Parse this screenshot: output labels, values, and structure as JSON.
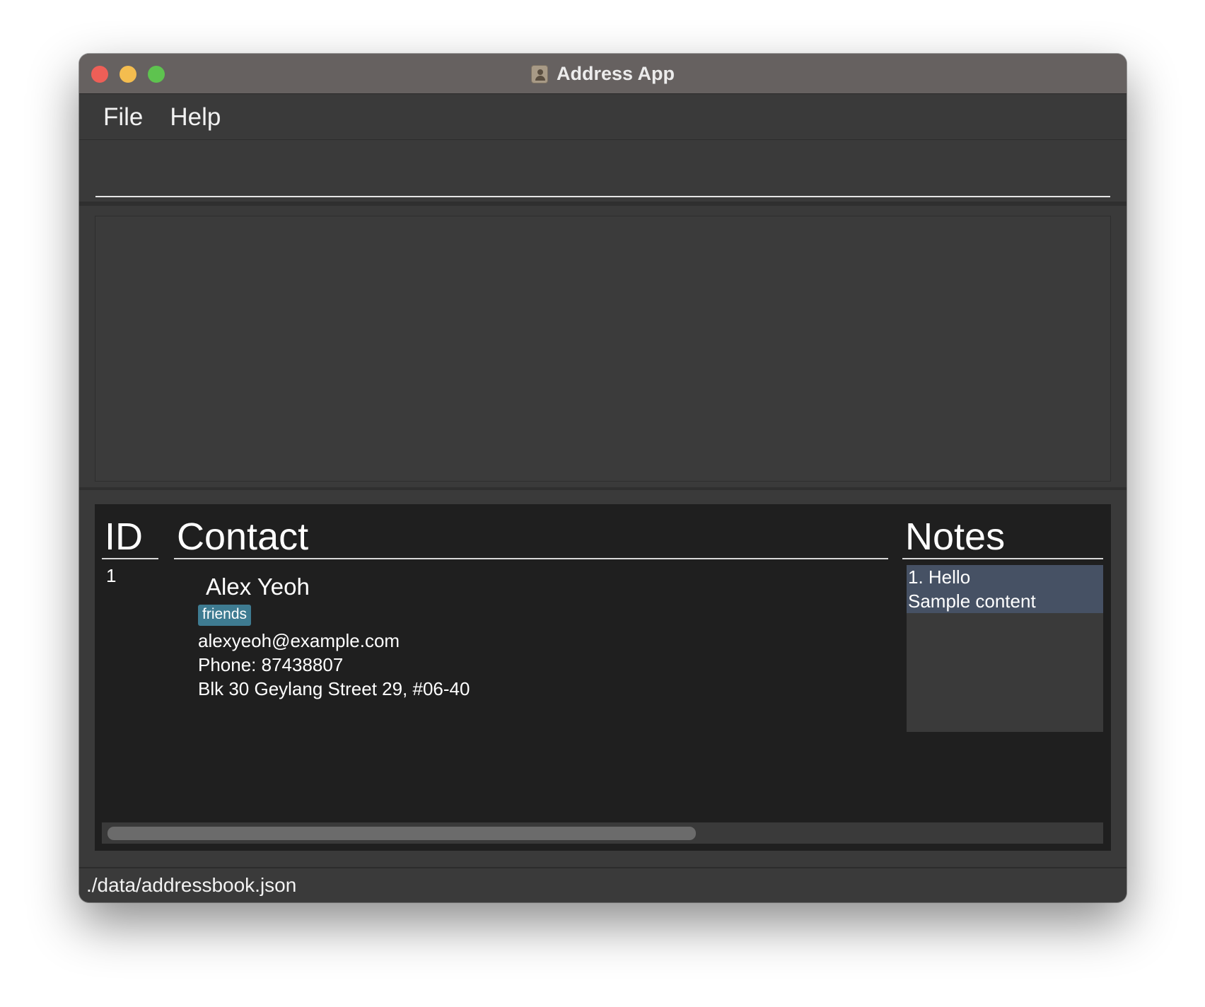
{
  "window": {
    "title": "Address App",
    "icon": "contact-book-icon"
  },
  "menu": {
    "items": [
      {
        "label": "File"
      },
      {
        "label": "Help"
      }
    ]
  },
  "command_box": {
    "value": "",
    "placeholder": ""
  },
  "result_display": {
    "text": ""
  },
  "person_list": {
    "headers": {
      "id": "ID",
      "contact": "Contact",
      "notes": "Notes"
    },
    "rows": [
      {
        "index": "1",
        "name": "Alex Yeoh",
        "tags": [
          "friends"
        ],
        "email": "alexyeoh@example.com",
        "phone": "Phone: 87438807",
        "address": "Blk 30 Geylang Street 29, #06-40",
        "notes": [
          {
            "title": "1. Hello",
            "content": "Sample content"
          }
        ]
      }
    ]
  },
  "status_bar": {
    "file_path": "./data/addressbook.json"
  },
  "colors": {
    "titlebar": "#666160",
    "panel": "#3a3a3a",
    "list_background": "#1f1f1f",
    "tag": "#3e7b91",
    "note_selected": "#465164"
  }
}
